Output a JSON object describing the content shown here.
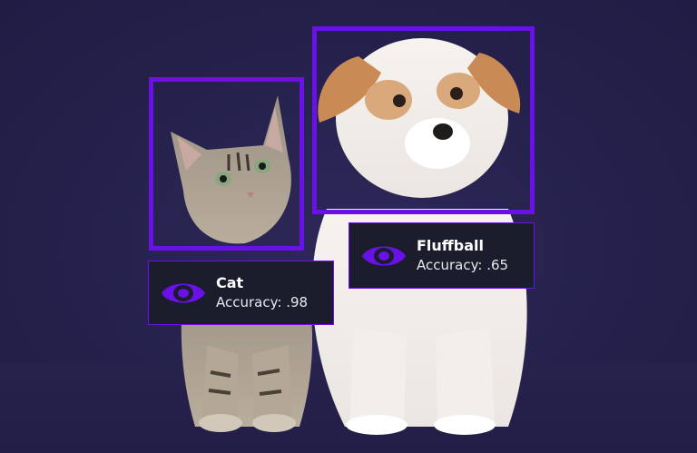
{
  "colors": {
    "background": "#24204a",
    "accent": "#6a11e8",
    "label_background": "#1b1c2c",
    "label_text": "#ffffff"
  },
  "detections": [
    {
      "name": "Cat",
      "accuracy": "Accuracy: .98",
      "icon": "eye-icon"
    },
    {
      "name": "Fluffball",
      "accuracy": "Accuracy: .65",
      "icon": "eye-icon"
    }
  ]
}
